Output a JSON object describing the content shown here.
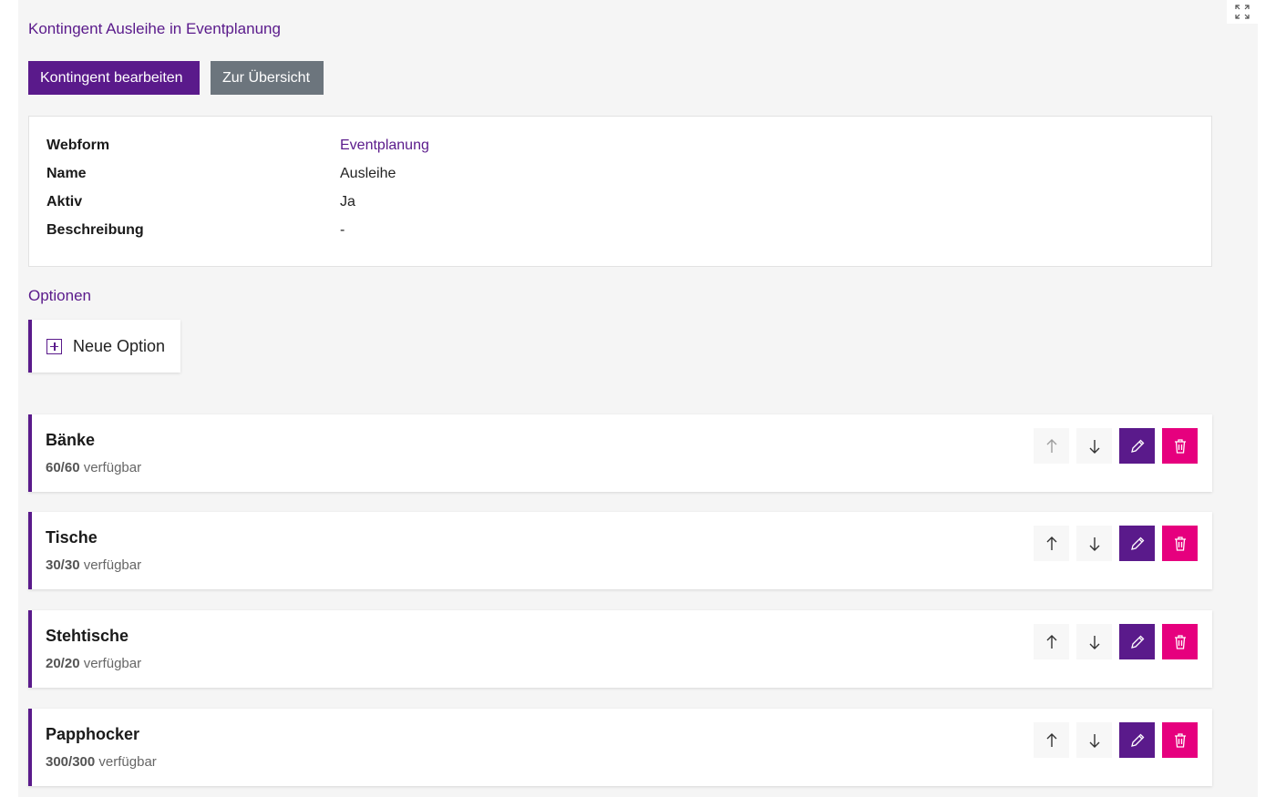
{
  "header": {
    "title": "Kontingent Ausleihe in Eventplanung"
  },
  "toolbar": {
    "edit_label": "Kontingent bearbeiten",
    "overview_label": "Zur Übersicht"
  },
  "details": [
    {
      "key": "Webform",
      "value": "Eventplanung",
      "link": true
    },
    {
      "key": "Name",
      "value": "Ausleihe",
      "link": false
    },
    {
      "key": "Aktiv",
      "value": "Ja",
      "link": false
    },
    {
      "key": "Beschreibung",
      "value": "-",
      "link": false
    }
  ],
  "options_section": {
    "title": "Optionen",
    "new_option_label": "Neue Option"
  },
  "options": [
    {
      "name": "Bänke",
      "count": "60/60",
      "suffix": "verfügbar",
      "up_disabled": true
    },
    {
      "name": "Tische",
      "count": "30/30",
      "suffix": "verfügbar",
      "up_disabled": false
    },
    {
      "name": "Stehtische",
      "count": "20/20",
      "suffix": "verfügbar",
      "up_disabled": false
    },
    {
      "name": "Papphocker",
      "count": "300/300",
      "suffix": "verfügbar",
      "up_disabled": false
    }
  ],
  "icons": {
    "expand": "expand-icon",
    "plus": "plus-square-icon",
    "up": "arrow-up-icon",
    "down": "arrow-down-icon",
    "edit": "pencil-icon",
    "delete": "trash-icon"
  },
  "colors": {
    "primary": "#5a1a8b",
    "secondary": "#6c757d",
    "danger": "#e6007e",
    "background": "#f5f5f5"
  }
}
